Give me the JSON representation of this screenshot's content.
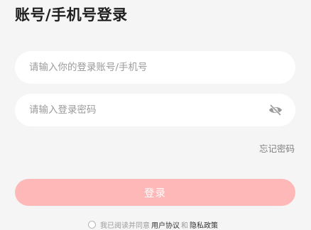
{
  "page": {
    "title": "账号/手机号登录"
  },
  "form": {
    "account_placeholder": "请输入你的登录账号/手机号",
    "account_value": "",
    "password_placeholder": "请输入登录密码",
    "password_value": "",
    "password_toggle_icon": "eye-closed-icon",
    "forgot_password": "忘记密码",
    "login_button": "登录"
  },
  "agreement": {
    "prefix": "我已阅读并同意",
    "user_agreement": "用户协议",
    "and": "和",
    "privacy_policy": "隐私政策",
    "checked": false
  },
  "colors": {
    "background": "#f5f5f6",
    "field_background": "#ffffff",
    "login_button": "#ffb8b8",
    "title": "#202020"
  }
}
